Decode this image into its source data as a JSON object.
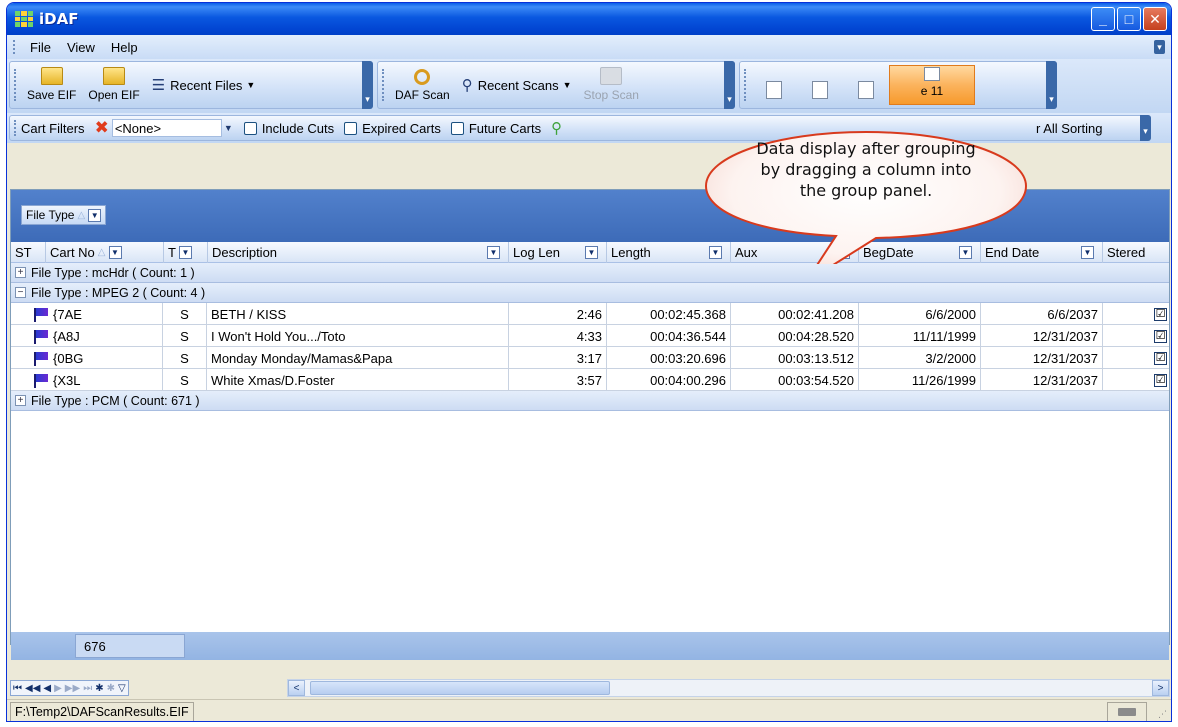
{
  "window": {
    "title": "iDAF"
  },
  "menu": {
    "items": [
      "File",
      "View",
      "Help"
    ]
  },
  "toolbar": {
    "save_eif": "Save EIF",
    "open_eif": "Open EIF",
    "recent_files": "Recent Files",
    "daf_scan": "DAF Scan",
    "recent_scans": "Recent Scans",
    "stop_scan": "Stop Scan",
    "partial_label": "e 11"
  },
  "filters": {
    "label": "Cart Filters",
    "value": "<None>",
    "include_cuts": "Include Cuts",
    "expired_carts": "Expired Carts",
    "future_carts": "Future Carts",
    "clear_sorting": "r All Sorting"
  },
  "group_panel": {
    "chip": "File Type"
  },
  "columns": [
    "ST",
    "Cart No",
    "T",
    "Description",
    "Log Len",
    "Length",
    "Aux",
    "BegDate",
    "End Date",
    "Stered"
  ],
  "groups": [
    {
      "label": "File Type : mcHdr ( Count: 1 )",
      "expanded": false
    },
    {
      "label": "File Type : MPEG 2 ( Count: 4 )",
      "expanded": true
    },
    {
      "label": "File Type : PCM ( Count: 671 )",
      "expanded": false
    }
  ],
  "rows": [
    {
      "cart": "{7AE",
      "t": "S",
      "desc": "BETH / KISS",
      "loglen": "2:46",
      "length": "00:02:45.368",
      "aux": "00:02:41.208",
      "beg": "6/6/2000",
      "end": "6/6/2037",
      "stereo": "☑"
    },
    {
      "cart": "{A8J",
      "t": "S",
      "desc": "I Won't Hold You.../Toto",
      "loglen": "4:33",
      "length": "00:04:36.544",
      "aux": "00:04:28.520",
      "beg": "11/11/1999",
      "end": "12/31/2037",
      "stereo": "☑"
    },
    {
      "cart": "{0BG",
      "t": "S",
      "desc": "Monday Monday/Mamas&Papa",
      "loglen": "3:17",
      "length": "00:03:20.696",
      "aux": "00:03:13.512",
      "beg": "3/2/2000",
      "end": "12/31/2037",
      "stereo": "☑"
    },
    {
      "cart": "{X3L",
      "t": "S",
      "desc": "White Xmas/D.Foster",
      "loglen": "3:57",
      "length": "00:04:00.296",
      "aux": "00:03:54.520",
      "beg": "11/26/1999",
      "end": "12/31/2037",
      "stereo": "☑"
    }
  ],
  "footer": {
    "count": "676"
  },
  "statusbar": {
    "path": "F:\\Temp2\\DAFScanResults.EIF"
  },
  "callout": {
    "text": "Data display after grouping by dragging a column into the group panel."
  },
  "icons": {
    "expand": "+",
    "collapse": "−",
    "dropdown": "▼",
    "sort": "△",
    "nav": [
      "⏮",
      "◀◀",
      "◀",
      "▶",
      "▶▶",
      "⏭",
      "✱",
      "✱",
      "▽"
    ]
  }
}
